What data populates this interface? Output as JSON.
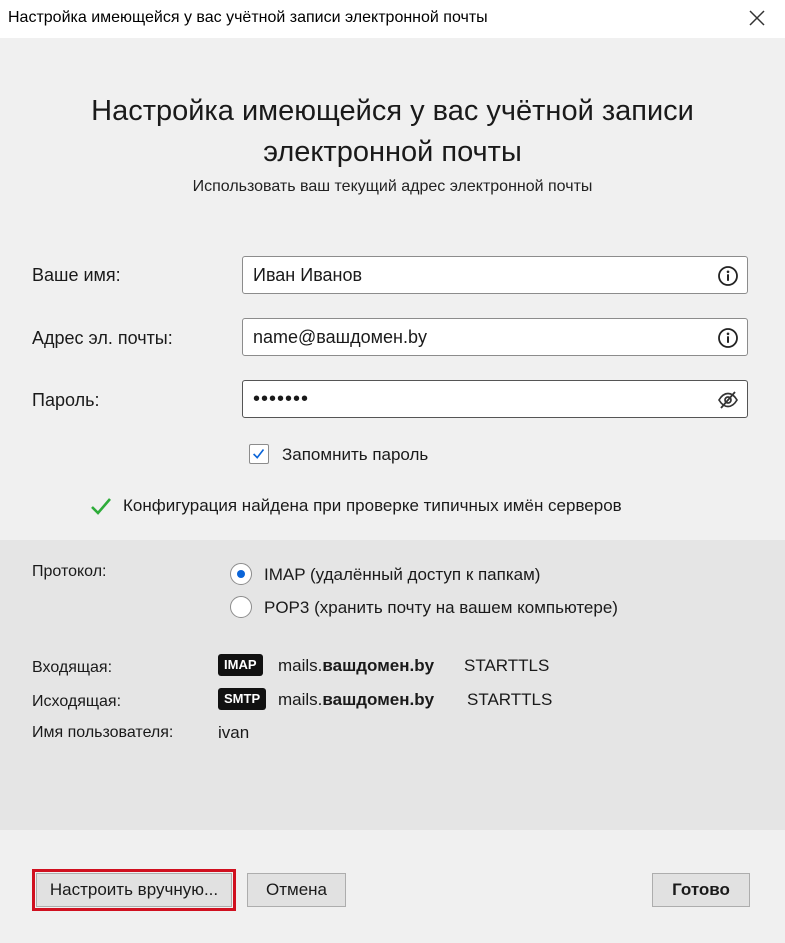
{
  "window": {
    "title": "Настройка имеющейся у вас учётной записи электронной почты"
  },
  "header": {
    "title_line1": "Настройка имеющейся у вас учётной записи",
    "title_line2": "электронной почты",
    "subtitle": "Использовать ваш текущий адрес электронной почты"
  },
  "form": {
    "name_label": "Ваше имя:",
    "name_value": "Иван Иванов",
    "email_label": "Адрес эл. почты:",
    "email_value": "name@вашдомен.by",
    "password_label": "Пароль:",
    "password_value": "•••••••",
    "remember_label": "Запомнить пароль",
    "remember_checked": true
  },
  "status": {
    "found_text": "Конфигурация найдена при проверке типичных имён серверов"
  },
  "config": {
    "protocol_label": "Протокол:",
    "options": [
      {
        "label": "IMAP (удалённый доступ к папкам)",
        "selected": true
      },
      {
        "label": "POP3 (хранить почту на вашем компьютере)",
        "selected": false
      }
    ],
    "incoming_label": "Входящая:",
    "incoming_tag": "IMAP",
    "incoming_host_prefix": "mails.",
    "incoming_host_domain": "вашдомен.by",
    "incoming_security": "STARTTLS",
    "outgoing_label": "Исходящая:",
    "outgoing_tag": "SMTP",
    "outgoing_host_prefix": "mails.",
    "outgoing_host_domain": "вашдомен.by",
    "outgoing_security": "STARTTLS",
    "username_label": "Имя пользователя:",
    "username_value": "ivan"
  },
  "buttons": {
    "manual": "Настроить вручную...",
    "cancel": "Отмена",
    "done": "Готово"
  },
  "colors": {
    "accent": "#0a64d8",
    "check_green": "#2eac3a",
    "highlight_red": "#d0101f"
  }
}
